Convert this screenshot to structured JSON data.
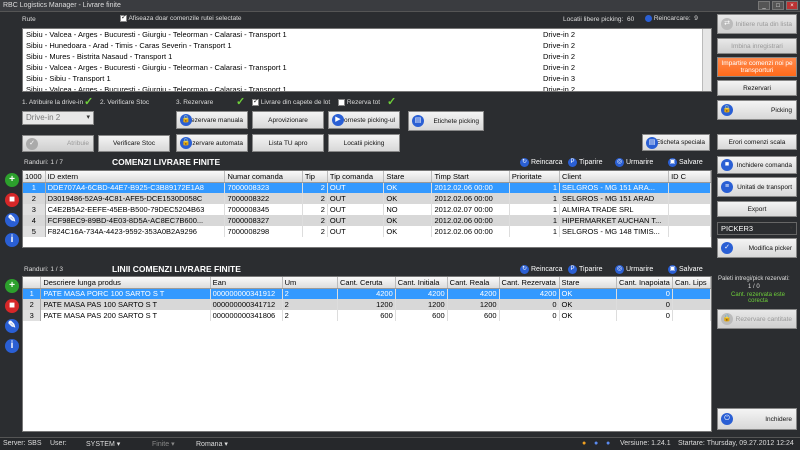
{
  "window": {
    "title": "RBC Logistics Manager - Livrare finite"
  },
  "routes": {
    "label": "Rute",
    "show_selected_label": "Afiseaza doar comenzile rutei selectate",
    "free_locations_label": "Locatii libere picking:",
    "free_locations_value": "60",
    "reload_label": "Reincarcare:",
    "reload_value": "9",
    "rows": [
      {
        "route": "Sibiu - Valcea - Arges - Bucuresti - Giurgiu - Teleorman - Calarasi - Transport 1",
        "drive": "Drive-in 2"
      },
      {
        "route": "Sibiu - Hunedoara - Arad - Timis - Caras Severin - Transport 1",
        "drive": "Drive-in 2"
      },
      {
        "route": "Sibiu - Mures - Bistrita Nasaud    - Transport 1",
        "drive": "Drive-in 2"
      },
      {
        "route": "Sibiu - Valcea - Arges - Bucuresti - Giurgiu - Teleorman - Calarasi - Transport 1",
        "drive": "Drive-in 2"
      },
      {
        "route": "Sibiu - Sibiu    - Transport 1",
        "drive": "Drive-in 3"
      },
      {
        "route": "Sibiu - Valcea - Arges - Bucuresti - Giurgiu - Teleorman - Calarasi - Transport 1",
        "drive": "Drive-in 2"
      }
    ]
  },
  "steps": {
    "s1": "1. Atribuire la drive-in",
    "s2": "2. Verificare Stoc",
    "s3": "3. Rezervare",
    "lots": "Livrare din capete de lot",
    "reserve_all": "Rezerva tot",
    "drive_select": "Drive-in 2"
  },
  "buttons": {
    "atribuie": "Atribuie",
    "verificare_stoc": "Verificare Stoc",
    "rezervare_manuala": "Rezervare manuala",
    "rezervare_automata": "Rezervare automata",
    "aprovizionare": "Aprovizionare",
    "lista_tu": "Lista TU apro",
    "porneste": "Porneste picking-ul",
    "locatii": "Locatii picking",
    "etichete": "Etichete picking",
    "eticheta_speciala": "Eticheta speciala",
    "initiere_ruta": "Initiere ruta din lista",
    "inbina": "Imbina inregistrari",
    "impartire": "Impartire comenzi noi pe transporturi",
    "rezervari": "Rezervari",
    "picking": "Picking",
    "erori": "Erori comenzi scala",
    "inchidere_comanda": "Inchidere comanda",
    "unitati": "Unitati de transport",
    "export": "Export",
    "picker": "PICKER3",
    "modifica_picker": "Modifica picker",
    "rezervare_cantitate": "Rezervare cantitate",
    "inchidere": "Inchidere"
  },
  "orders": {
    "count_label": "Randuri:  1 / 7",
    "title": "COMENZI LIVRARE FINITE",
    "toolbar": {
      "reload": "Reincarca",
      "print": "Tiparire",
      "track": "Urmarire",
      "save": "Salvare"
    },
    "columns": [
      "1000",
      "ID extern",
      "Numar comanda",
      "Tip",
      "Tip comanda",
      "Stare",
      "Timp Start",
      "Prioritate",
      "Client",
      "ID C"
    ],
    "rows": [
      {
        "n": "1",
        "ext": "DDE707A4-6CBD-44E7-B925-C3B89172E1A8",
        "num": "7000008323",
        "tip": "2",
        "tc": "OUT",
        "st": "OK",
        "ts": "2012.02.06 00:00",
        "pr": "1",
        "cl": "SELGROS - MG 151 ARA..."
      },
      {
        "n": "2",
        "ext": "D3019486-52A9-4C81-AFE5-DCE1530D058C",
        "num": "7000008322",
        "tip": "2",
        "tc": "OUT",
        "st": "OK",
        "ts": "2012.02.06 00:00",
        "pr": "1",
        "cl": "SELGROS - MG 151 ARAD"
      },
      {
        "n": "3",
        "ext": "C4E2B5A2-EEFE-45EB-B500-79DEC5204B63",
        "num": "7000008345",
        "tip": "2",
        "tc": "OUT",
        "st": "NO",
        "ts": "2012.02.07 00:00",
        "pr": "1",
        "cl": "ALMIRA TRADE SRL"
      },
      {
        "n": "4",
        "ext": "FCF98EC9-89BD-4E03-8D5A-AC8EC7B600...",
        "num": "7000008327",
        "tip": "2",
        "tc": "OUT",
        "st": "OK",
        "ts": "2012.02.06 00:00",
        "pr": "1",
        "cl": "HIPERMARKET AUCHAN T..."
      },
      {
        "n": "5",
        "ext": "F824C16A-734A-4423-9592-353A0B2A9296",
        "num": "7000008298",
        "tip": "2",
        "tc": "OUT",
        "st": "OK",
        "ts": "2012.02.06 00:00",
        "pr": "1",
        "cl": "SELGROS - MG 148 TIMIS..."
      }
    ]
  },
  "lines": {
    "count_label": "Randuri:  1 / 3",
    "title": "LINII COMENZI LIVRARE FINITE",
    "toolbar": {
      "reload": "Reincarca",
      "print": "Tiparire",
      "track": "Urmarire",
      "save": "Salvare"
    },
    "columns": [
      "",
      "Descriere lunga produs",
      "Ean",
      "Um",
      "Cant. Ceruta",
      "Cant. Initiala",
      "Cant. Reala",
      "Cant. Rezervata",
      "Stare",
      "Cant. Inapoiata",
      "Can. Lips"
    ],
    "rows": [
      {
        "n": "1",
        "desc": "PATE MASA PORC 100 SARTO S T",
        "ean": "000000000341912",
        "um": "2",
        "c": "4200",
        "i": "4200",
        "r": "4200",
        "z": "4200",
        "st": "OK",
        "inap": "0"
      },
      {
        "n": "2",
        "desc": "PATE MASA PAS 100 SARTO S T",
        "ean": "000000000341712",
        "um": "2",
        "c": "1200",
        "i": "1200",
        "r": "1200",
        "z": "0",
        "st": "OK",
        "inap": "0"
      },
      {
        "n": "3",
        "desc": "PATE MASA PAS 200 SARTO S T",
        "ean": "000000000341806",
        "um": "2",
        "c": "600",
        "i": "600",
        "r": "600",
        "z": "0",
        "st": "OK",
        "inap": "0"
      }
    ]
  },
  "side_info": {
    "paleti": "Paleti intregi/pick rezervati:",
    "paleti_val": "1 / 0",
    "cant_msg": "Cant. rezervata este corecta"
  },
  "status": {
    "server_label": "Server:",
    "server": "SBS",
    "user_label": "User:",
    "user": "SYSTEM",
    "finite": "Finite",
    "lang": "Romana",
    "version_label": "Versiune:",
    "version": "1.24.1",
    "start_label": "Startare:",
    "start": "Thursday, 09.27.2012 12:24"
  },
  "colors": {
    "accent": "#3399ff",
    "orange": "#ff6a1a",
    "green": "#2ca02c",
    "red": "#d62728"
  }
}
